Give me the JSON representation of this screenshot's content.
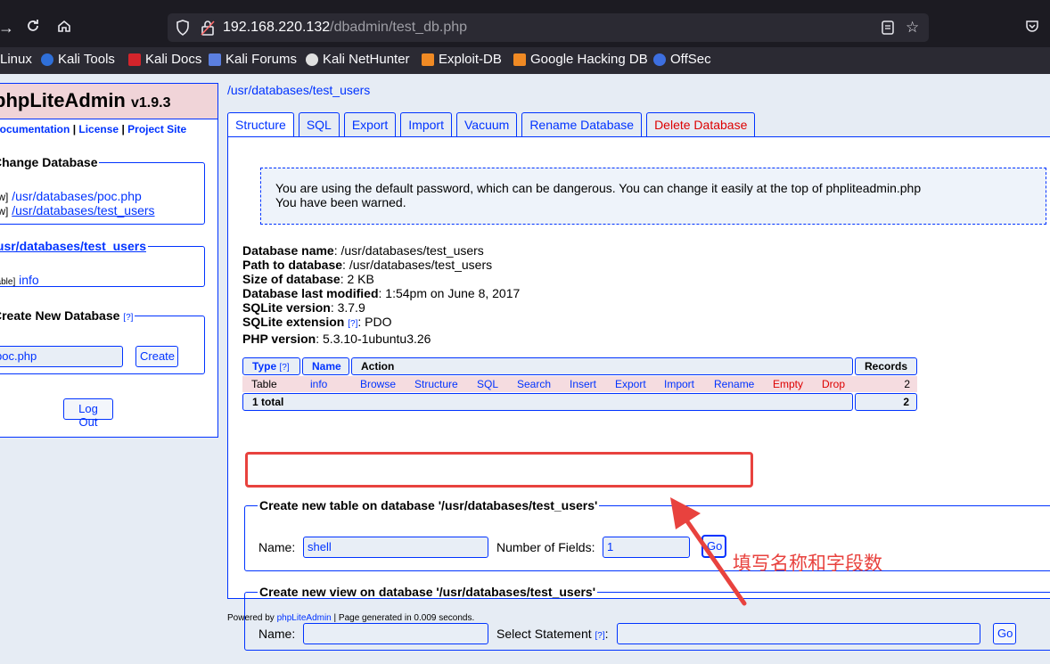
{
  "browser": {
    "url_host": "192.168.220.132",
    "url_path": "/dbadmin/test_db.php",
    "bookmarks": [
      "Linux",
      "Kali Tools",
      "Kali Docs",
      "Kali Forums",
      "Kali NetHunter",
      "Exploit-DB",
      "Google Hacking DB",
      "OffSec"
    ]
  },
  "sidebar": {
    "app_name": "phpLiteAdmin",
    "version": "v1.9.3",
    "links": {
      "documentation": "Documentation",
      "license": "License",
      "project_site": "Project Site",
      "sep": "|"
    },
    "change_db": {
      "legend": "Change Database",
      "items": [
        {
          "prefix": "[rw]",
          "path": "/usr/databases/poc.php"
        },
        {
          "prefix": "[rw]",
          "path": "/usr/databases/test_users"
        }
      ]
    },
    "current_db": {
      "legend": "/usr/databases/test_users",
      "prefix": "[table]",
      "table": "info"
    },
    "create_db": {
      "legend": "Create New Database",
      "help": "[?]",
      "input_value": "poc.php",
      "button": "Create"
    },
    "logout": "Log Out"
  },
  "breadcrumb": "/usr/databases/test_users",
  "tabs": [
    {
      "label": "Structure",
      "active": true
    },
    {
      "label": "SQL"
    },
    {
      "label": "Export"
    },
    {
      "label": "Import"
    },
    {
      "label": "Vacuum"
    },
    {
      "label": "Rename Database"
    },
    {
      "label": "Delete Database",
      "danger": true
    }
  ],
  "warning": {
    "line1": "You are using the default password, which can be dangerous. You can change it easily at the top of phpliteadmin.php",
    "line2": "You have been warned."
  },
  "db_info": {
    "name_label": "Database name",
    "name": "/usr/databases/test_users",
    "path_label": "Path to database",
    "path": "/usr/databases/test_users",
    "size_label": "Size of database",
    "size": "2 KB",
    "modified_label": "Database last modified",
    "modified": "1:54pm on June 8, 2017",
    "sqlite_label": "SQLite version",
    "sqlite": "3.7.9",
    "ext_label": "SQLite extension",
    "ext_help": "[?]",
    "ext": "PDO",
    "php_label": "PHP version",
    "php": "5.3.10-1ubuntu3.26"
  },
  "table": {
    "headers": {
      "type": "Type",
      "type_help": "[?]",
      "name": "Name",
      "action": "Action",
      "records": "Records"
    },
    "row": {
      "type": "Table",
      "name": "info",
      "actions": [
        "Browse",
        "Structure",
        "SQL",
        "Search",
        "Insert",
        "Export",
        "Import",
        "Rename",
        "Empty",
        "Drop"
      ],
      "records": "2"
    },
    "total_label": "1 total",
    "total_records": "2"
  },
  "create_table": {
    "legend": "Create new table on database '/usr/databases/test_users'",
    "name_label": "Name:",
    "name_value": "shell",
    "fields_label": "Number of Fields:",
    "fields_value": "1",
    "go": "Go"
  },
  "create_view": {
    "legend": "Create new view on database '/usr/databases/test_users'",
    "name_label": "Name:",
    "name_value": "",
    "stmt_label": "Select Statement",
    "stmt_help": "[?]",
    "stmt_colon": ":",
    "stmt_value": "",
    "go": "Go"
  },
  "footer": {
    "prefix": "Powered by",
    "link": "phpLiteAdmin",
    "suffix": "| Page generated in 0.009 seconds."
  },
  "annotation": "填写名称和字段数",
  "colors": {
    "accent": "#0033ff",
    "annotation_red": "#e8423e",
    "header_pink": "#f0d4d8"
  }
}
